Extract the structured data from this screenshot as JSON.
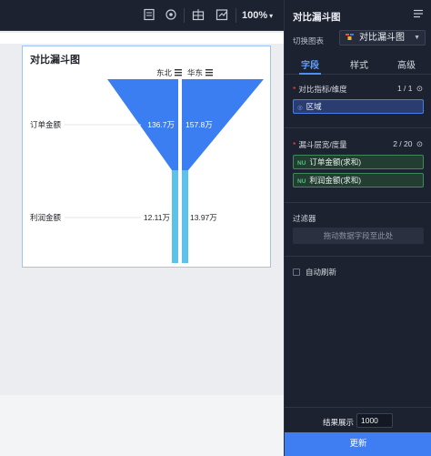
{
  "toolbar": {
    "zoom": "100%",
    "icons": [
      "save-icon",
      "preview-icon",
      "layout-icon",
      "export-icon"
    ]
  },
  "chart": {
    "title": "对比漏斗图"
  },
  "panel": {
    "title": "对比漏斗图",
    "switch_label": "切换图表",
    "chart_type": "对比漏斗图",
    "tabs": [
      "字段",
      "样式",
      "高级"
    ],
    "compare_section": {
      "label": "对比指标/维度",
      "count": "1 / 1"
    },
    "compare_fields": [
      "区域"
    ],
    "funnel_section": {
      "label": "漏斗层宽/度量",
      "count": "2 / 20"
    },
    "funnel_fields": [
      "订单金额(求和)",
      "利润金额(求和)"
    ],
    "measure_tag": "NU",
    "filter_label": "过滤器",
    "drop_hint": "拖动数据字段至此处",
    "auto_refresh": "自动刷新",
    "result_label": "结果展示",
    "result_value": "1000",
    "update_button": "更新"
  },
  "chart_data": {
    "type": "bar",
    "subtype": "compare-funnel",
    "title": "对比漏斗图",
    "categories": [
      "订单金额",
      "利润金额"
    ],
    "series": [
      {
        "name": "东北",
        "values": [
          136.7,
          12.11
        ],
        "labels": [
          "136.7万",
          "12.11万"
        ]
      },
      {
        "name": "华东",
        "values": [
          157.8,
          13.97
        ],
        "labels": [
          "157.8万",
          "13.97万"
        ]
      }
    ],
    "unit": "万",
    "colors": {
      "funnel": "#3a7ef2",
      "stem": "#5cc2ea"
    }
  }
}
